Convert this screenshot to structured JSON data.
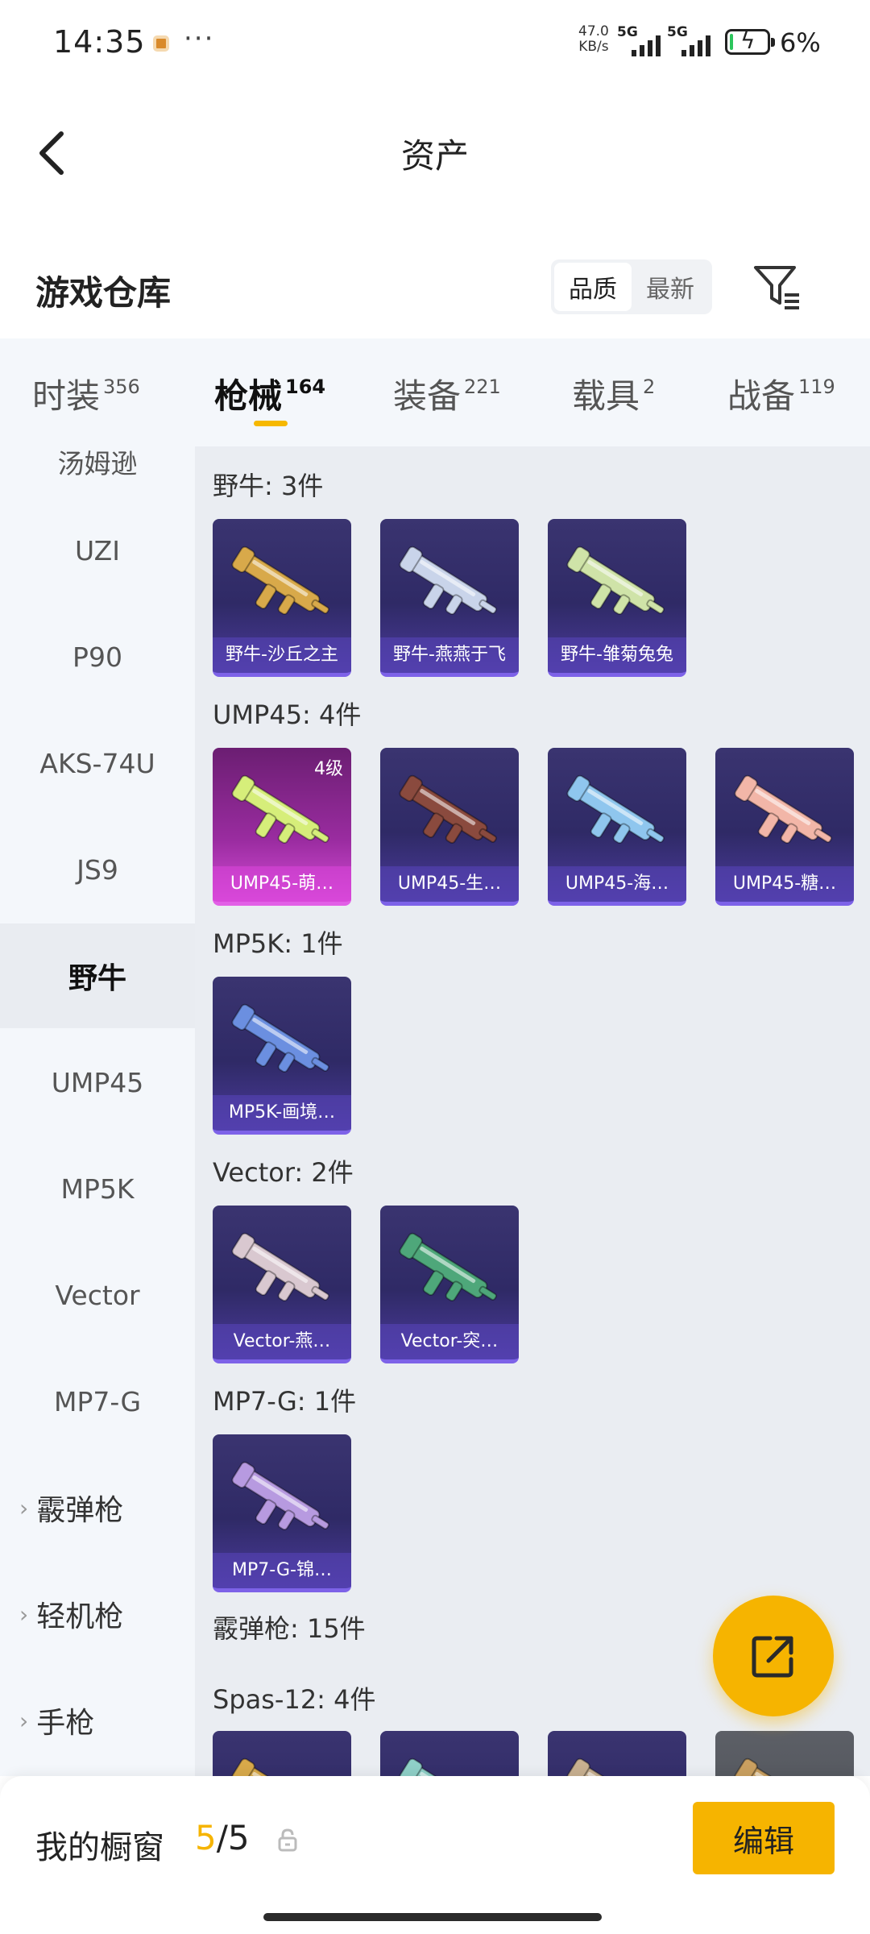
{
  "status_bar": {
    "time": "14:35",
    "more": "···",
    "net_speed_value": "47.0",
    "net_speed_unit": "KB/s",
    "sim1": "5G",
    "sim2": "5G",
    "battery_percent": "6%",
    "battery_level": 0.06
  },
  "header": {
    "back_icon": "chevron-left-icon",
    "title": "资产"
  },
  "warehouse": {
    "label": "游戏仓库",
    "sort_options": [
      "品质",
      "最新"
    ],
    "sort_selected": "品质",
    "filter_icon": "filter-icon"
  },
  "tabs": [
    {
      "label": "时装",
      "count": "356"
    },
    {
      "label": "枪械",
      "count": "164",
      "active": true
    },
    {
      "label": "装备",
      "count": "221"
    },
    {
      "label": "载具",
      "count": "2"
    },
    {
      "label": "战备",
      "count": "119"
    }
  ],
  "sidebar": {
    "partial_top": "汤姆逊",
    "items": [
      "UZI",
      "P90",
      "AKS-74U",
      "JS9",
      "野牛",
      "UMP45",
      "MP5K",
      "Vector",
      "MP7-G"
    ],
    "active": "野牛",
    "groups": [
      "霰弹枪",
      "轻机枪",
      "手枪"
    ]
  },
  "sections": [
    {
      "title": "野牛: 3件",
      "cards": [
        {
          "name": "野牛-沙丘之主",
          "color": "#d8a94a"
        },
        {
          "name": "野牛-燕燕于飞",
          "color": "#c9d4ea"
        },
        {
          "name": "野牛-雏菊兔兔",
          "color": "#cfe3a8"
        }
      ]
    },
    {
      "title": "UMP45: 4件",
      "cards": [
        {
          "name": "UMP45-萌…",
          "color": "#d6ee7a",
          "level": "4级",
          "pink": true
        },
        {
          "name": "UMP45-生…",
          "color": "#8a4a3e"
        },
        {
          "name": "UMP45-海…",
          "color": "#8fc6ee"
        },
        {
          "name": "UMP45-糖…",
          "color": "#f2b6a8"
        }
      ]
    },
    {
      "title": "MP5K: 1件",
      "cards": [
        {
          "name": "MP5K-画境…",
          "color": "#6b8fe0"
        }
      ]
    },
    {
      "title": "Vector: 2件",
      "cards": [
        {
          "name": "Vector-燕…",
          "color": "#d9c8d0"
        },
        {
          "name": "Vector-突…",
          "color": "#4ea77a"
        }
      ]
    },
    {
      "title": "MP7-G: 1件",
      "cards": [
        {
          "name": "MP7-G-锦…",
          "color": "#b79ae0"
        }
      ]
    },
    {
      "title": "霰弹枪: 15件",
      "cards": []
    },
    {
      "title": "Spas-12: 4件",
      "cards": [
        {
          "name": "",
          "color": "#d8a94a"
        },
        {
          "name": "",
          "color": "#8fd0c8"
        },
        {
          "name": "",
          "color": "#c8b090"
        },
        {
          "name": "",
          "color": "#caa060",
          "grey": true
        }
      ]
    }
  ],
  "fab_icon": "share-external-icon",
  "bottom": {
    "label": "我的橱窗",
    "current": "5",
    "total": "/5",
    "lock_icon": "lock-icon",
    "edit_label": "编辑"
  },
  "accent_color": "#f6b400"
}
